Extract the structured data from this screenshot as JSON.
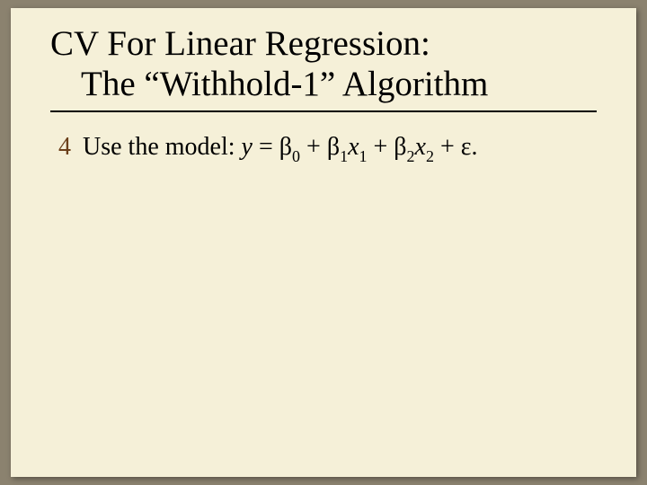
{
  "title": {
    "line1": "CV For Linear Regression:",
    "line2": "The “Withhold-1” Algorithm"
  },
  "bullet": {
    "icon": "4",
    "lead": "Use the model: ",
    "eq": {
      "y": "y",
      "eq_sign": " = ",
      "b0": "β",
      "s0": "0",
      "plus1": " + ",
      "b1": "β",
      "s1": "1",
      "x1": "x",
      "sx1": "1",
      "plus2": " + ",
      "b2": "β",
      "s2": "2",
      "x2": "x",
      "sx2": "2",
      "plus3": " + ",
      "eps": "ε",
      "dot": "."
    }
  }
}
